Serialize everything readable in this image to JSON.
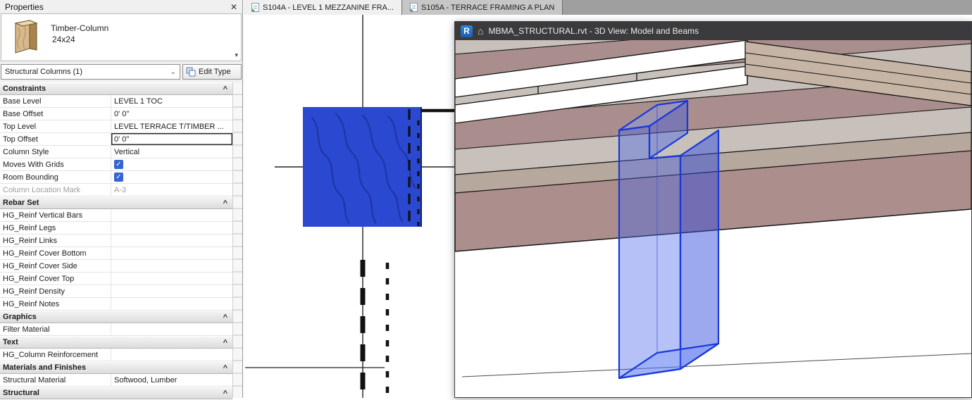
{
  "colors": {
    "accent-blue": "#2b48d0",
    "grain-blue": "#1d339f",
    "column-3d-stroke": "#1838d8",
    "deck-mauve": "#ac8f8d",
    "plank-light": "#c8c1bb",
    "plank-mauve": "#a98e8d",
    "beam-tan": "#b7a89e",
    "upper-tan": "#c6b5a4",
    "check-blue": "#3465d0",
    "titlebar-dark": "#3b3b3d"
  },
  "properties_panel": {
    "title": "Properties",
    "close_icon": "✕",
    "type_selector": {
      "family": "Timber-Column",
      "type_name": "24x24",
      "dropdown_icon": "▾"
    },
    "selection": {
      "label": "Structural Columns (1)",
      "dropdown_icon": "⌄"
    },
    "edit_type": {
      "label": "Edit Type"
    },
    "collapse_icon": "^",
    "check_icon": "✓",
    "groups": [
      {
        "header": "Constraints",
        "rows": [
          {
            "label": "Base Level",
            "value": "LEVEL 1 TOC"
          },
          {
            "label": "Base Offset",
            "value": "0'  0\""
          },
          {
            "label": "Top Level",
            "value": "LEVEL TERRACE T/TIMBER ..."
          },
          {
            "label": "Top Offset",
            "value": "0'  0\"",
            "focused": true
          },
          {
            "label": "Column Style",
            "value": "Vertical"
          },
          {
            "label": "Moves With Grids",
            "checkbox": true,
            "checked": true
          },
          {
            "label": "Room Bounding",
            "checkbox": true,
            "checked": true
          },
          {
            "label": "Column Location Mark",
            "value": "A-3",
            "disabled": true
          }
        ]
      },
      {
        "header": "Rebar Set",
        "rows": [
          {
            "label": "HG_Reinf Vertical Bars",
            "value": ""
          },
          {
            "label": "HG_Reinf Legs",
            "value": ""
          },
          {
            "label": "HG_Reinf Links",
            "value": ""
          },
          {
            "label": "HG_Reinf Cover Bottom",
            "value": ""
          },
          {
            "label": "HG_Reinf Cover Side",
            "value": ""
          },
          {
            "label": "HG_Reinf Cover Top",
            "value": ""
          },
          {
            "label": "HG_Reinf Density",
            "value": ""
          },
          {
            "label": "HG_Reinf Notes",
            "value": ""
          }
        ]
      },
      {
        "header": "Graphics",
        "rows": [
          {
            "label": "Filter Material",
            "value": ""
          }
        ]
      },
      {
        "header": "Text",
        "rows": [
          {
            "label": "HG_Column Reinforcement",
            "value": ""
          }
        ]
      },
      {
        "header": "Materials and Finishes",
        "rows": [
          {
            "label": "Structural Material",
            "value": "Softwood, Lumber"
          }
        ]
      },
      {
        "header": "Structural",
        "rows": []
      }
    ]
  },
  "view_tabs": [
    {
      "label": "S104A - LEVEL 1 MEZZANINE FRA...",
      "active": true
    },
    {
      "label": "S105A - TERRACE FRAMING A PLAN",
      "active": false
    }
  ],
  "floating_window": {
    "revit_icon_letter": "R",
    "home_icon": "⌂",
    "title": "MBMA_STRUCTURAL.rvt - 3D View: Model and Beams"
  }
}
